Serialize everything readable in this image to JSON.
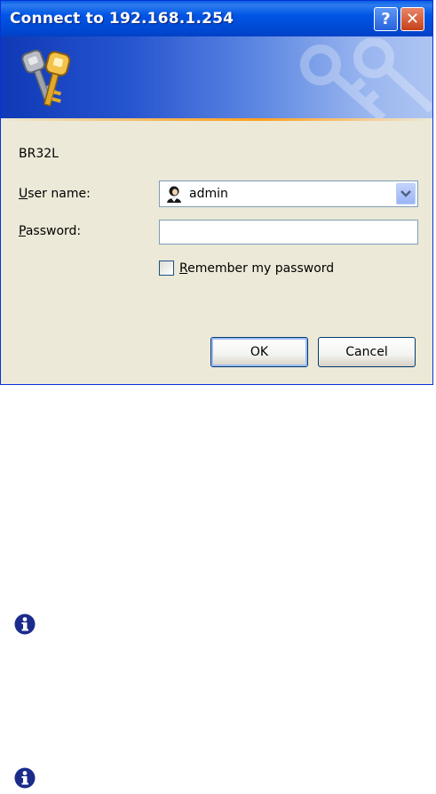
{
  "dialog": {
    "title": "Connect to 192.168.1.254",
    "help_glyph": "?",
    "close_glyph": "✕",
    "banner_icon": "keys-icon",
    "server_name": "BR32L",
    "user_label_accel": "U",
    "user_label_rest": "ser name:",
    "username_value": "admin",
    "password_label_accel": "P",
    "password_label_rest": "assword:",
    "password_value": "",
    "remember_label_accel": "R",
    "remember_label_rest": "emember my password",
    "remember_checked": false,
    "ok_label": "OK",
    "cancel_label": "Cancel"
  },
  "notes": {
    "icons": [
      "info-icon",
      "info-icon"
    ]
  },
  "colors": {
    "titlebar": "#0055e5",
    "dialog_bg": "#ece9d8",
    "info_icon": "#1a2b8c"
  }
}
